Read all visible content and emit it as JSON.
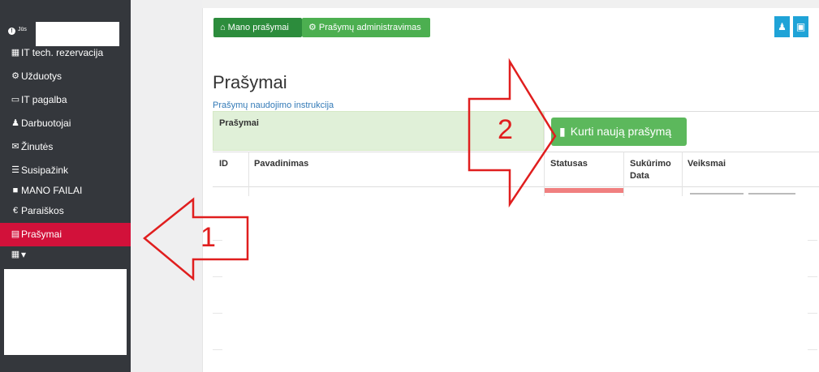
{
  "sidebar": {
    "user_label": "Jūs",
    "items": [
      {
        "label": "IT tech. rezervacija",
        "icon": "calendar-icon",
        "glyph": "▦"
      },
      {
        "label": "Užduotys",
        "icon": "cogs-icon",
        "glyph": "⚙"
      },
      {
        "label": "IT pagalba",
        "icon": "monitor-icon",
        "glyph": "▭"
      },
      {
        "label": "Darbuotojai",
        "icon": "person-icon",
        "glyph": "♟"
      },
      {
        "label": "Žinutės",
        "icon": "envelope-icon",
        "glyph": "✉"
      },
      {
        "label": "Susipažink",
        "icon": "list-icon",
        "glyph": "☰"
      },
      {
        "label": "MANO FAILAI",
        "icon": "folder-icon",
        "glyph": "■"
      },
      {
        "label": "Paraiškos",
        "icon": "euro-icon",
        "glyph": "€"
      },
      {
        "label": "Prašymai",
        "icon": "documents-icon",
        "glyph": "▤"
      },
      {
        "label": "▾",
        "icon": "grid-icon",
        "glyph": "▦"
      }
    ]
  },
  "toolbar": {
    "my_requests": "Mano prašymai",
    "admin": "Prašymų administravimas"
  },
  "page": {
    "title": "Prašymai",
    "instructions_link": "Prašymų naudojimo instrukcija",
    "panel_title": "Prašymai",
    "create_button": "Kurti naują prašymą"
  },
  "table": {
    "headers": [
      "ID",
      "Pavadinimas",
      "Statusas",
      "Sukūrimo Data",
      "Veiksmai"
    ]
  },
  "annotations": {
    "one": "1",
    "two": "2"
  },
  "colors": {
    "sidebar": "#34373c",
    "active": "#d2113a",
    "green_dark": "#2c8c3c",
    "green": "#5cb85c",
    "annotation": "#e01e1e",
    "accent_blue": "#1fa3d7"
  }
}
